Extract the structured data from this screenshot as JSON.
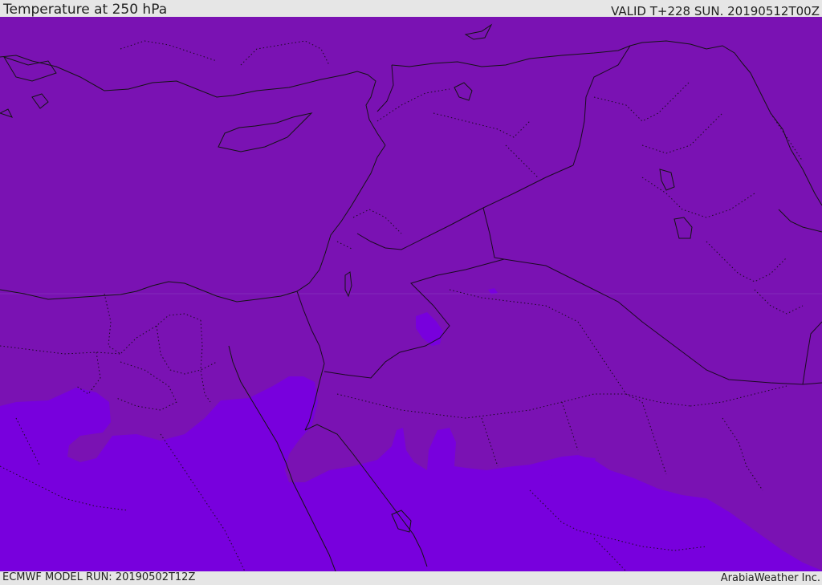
{
  "header": {
    "title": "Temperature at 250 hPa",
    "valid": "VALID T+228 SUN. 20190512T00Z"
  },
  "footer": {
    "model_run": "ECMWF MODEL RUN: 20190502T12Z",
    "credit": "ArabiaWeather Inc."
  },
  "map": {
    "colors": {
      "field_main": "#7a12b3",
      "field_warm": "#7800dd",
      "coastline": "#141414",
      "background": "#e6e6e6"
    }
  }
}
